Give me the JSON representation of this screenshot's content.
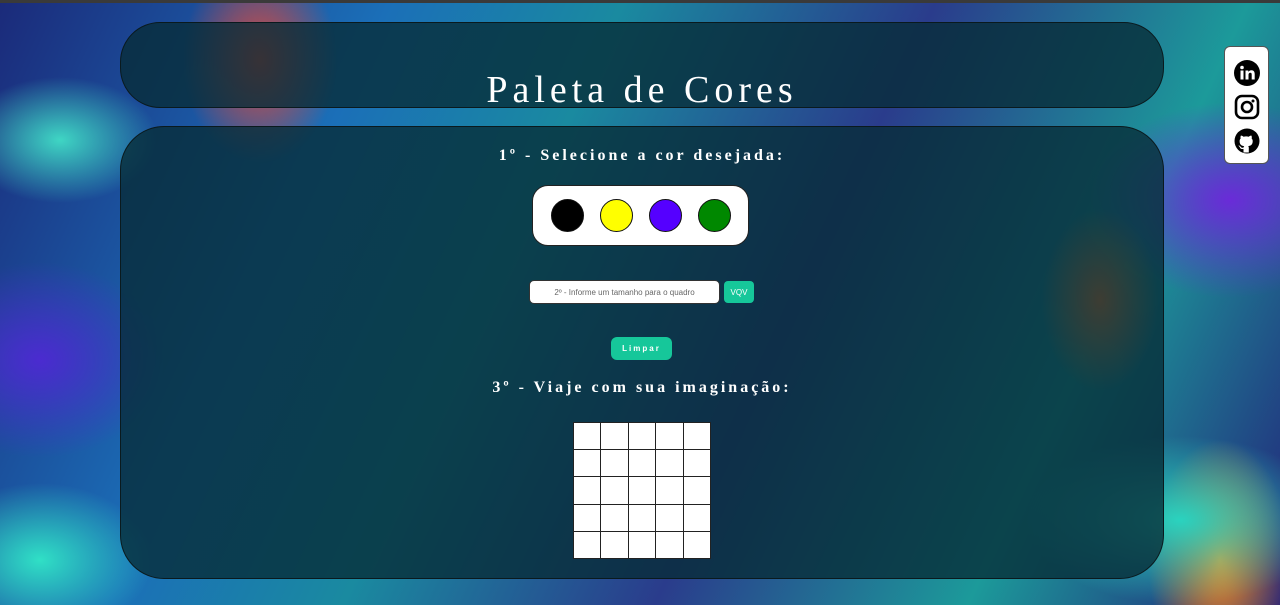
{
  "header": {
    "title": "Paleta de Cores"
  },
  "steps": {
    "select_color": "1º - Selecione a cor desejada:",
    "travel": "3º - Viaje com sua imaginação:"
  },
  "palette": {
    "colors": [
      "#000000",
      "#ffff00",
      "#5500ff",
      "#008800"
    ]
  },
  "board_size": {
    "placeholder": "2º - Informe um tamanho para o quadro",
    "value": "",
    "submit_label": "VQV"
  },
  "clear_button": {
    "label": "Limpar"
  },
  "board": {
    "rows": 5,
    "cols": 5,
    "pixel_color": "#ffffff"
  },
  "social": {
    "icons": [
      "linkedin-icon",
      "instagram-icon",
      "github-icon"
    ]
  }
}
